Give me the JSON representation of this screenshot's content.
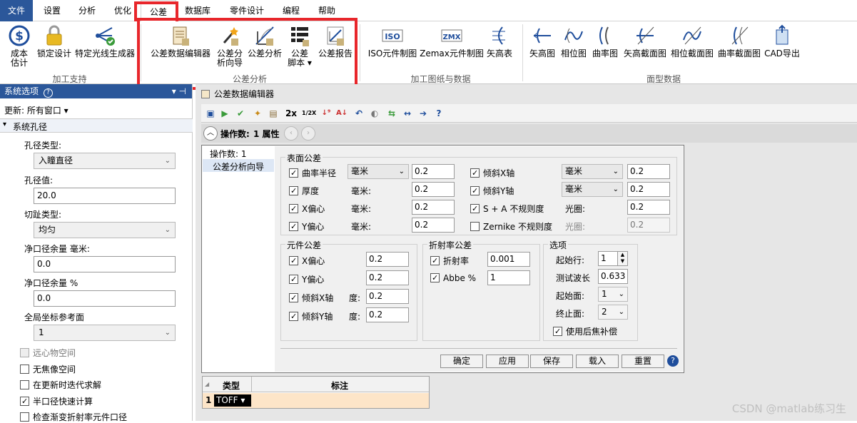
{
  "menu": {
    "file": "文件",
    "items": [
      "设置",
      "分析",
      "优化",
      "公差",
      "数据库",
      "零件设计",
      "编程",
      "帮助"
    ]
  },
  "ribbon": {
    "machining": {
      "cost": "成本\n估计",
      "lock": "锁定设计",
      "ray": "特定光线生成器",
      "label": "加工支持"
    },
    "tolerance": {
      "editor": "公差数据编辑器",
      "wizard1": "公差分",
      "wizard2": "析向导",
      "analysis": "公差分析",
      "script1": "公差",
      "script2": "脚本 ▾",
      "report": "公差报告",
      "label": "公差分析"
    },
    "drawing": {
      "iso": "ISO元件制图",
      "zemax": "Zemax元件制图",
      "sag": "矢高表",
      "label": "加工图纸与数据"
    },
    "surface": {
      "sagmap": "矢高图",
      "phasemap": "相位图",
      "curvmap": "曲率图",
      "sagcross": "矢高截面图",
      "phasecross": "相位截面图",
      "curvcross": "曲率截面图",
      "cad": "CAD导出",
      "label": "面型数据"
    }
  },
  "left": {
    "title": "系统选项",
    "update": "更新: 所有窗口 ▾",
    "section": "系统孔径",
    "aperture_type_label": "孔径类型:",
    "aperture_type": "入瞳直径",
    "aperture_value_label": "孔径值:",
    "aperture_value": "20.0",
    "apodization_label": "切趾类型:",
    "apodization": "均匀",
    "clear_mm_label": "净口径余量 毫米:",
    "clear_mm": "0.0",
    "clear_pct_label": "净口径余量 %",
    "clear_pct": "0.0",
    "global_ref_label": "全局坐标参考面",
    "global_ref": "1",
    "checks": [
      {
        "label": "远心物空间",
        "checked": false,
        "disabled": true
      },
      {
        "label": "无焦像空间",
        "checked": false,
        "disabled": false
      },
      {
        "label": "在更新时迭代求解",
        "checked": false,
        "disabled": false
      },
      {
        "label": "半口径快速计算",
        "checked": true,
        "disabled": false
      },
      {
        "label": "检查渐变折射率元件口径",
        "checked": false,
        "disabled": false
      }
    ]
  },
  "editor": {
    "window_title": "公差数据编辑器",
    "ops_label": "操作数:",
    "ops_value": "1 属性",
    "tree": [
      "操作数: 1",
      "公差分析向导"
    ],
    "surface_tol": {
      "title": "表面公差",
      "rows": [
        {
          "label": "曲率半径",
          "unit": "毫米",
          "unit_select": true,
          "value": "0.2",
          "checked": true
        },
        {
          "label": "厚度",
          "unit": "毫米:",
          "unit_select": false,
          "value": "0.2",
          "checked": true
        },
        {
          "label": "X偏心",
          "unit": "毫米:",
          "unit_select": false,
          "value": "0.2",
          "checked": true
        },
        {
          "label": "Y偏心",
          "unit": "毫米:",
          "unit_select": false,
          "value": "0.2",
          "checked": true
        }
      ],
      "rows_right": [
        {
          "label": "倾斜X轴",
          "unit": "毫米",
          "unit_select": true,
          "value": "0.2",
          "checked": true,
          "disabled": false
        },
        {
          "label": "倾斜Y轴",
          "unit": "毫米",
          "unit_select": true,
          "value": "0.2",
          "checked": true,
          "disabled": false
        },
        {
          "label": "S + A 不规则度",
          "unit": "光圈:",
          "unit_select": false,
          "value": "0.2",
          "checked": true,
          "disabled": false
        },
        {
          "label": "Zernike 不规则度",
          "unit": "光圈:",
          "unit_select": false,
          "value": "0.2",
          "checked": false,
          "disabled": true
        }
      ]
    },
    "element_tol": {
      "title": "元件公差",
      "rows": [
        {
          "label": "X偏心",
          "unit": "",
          "value": "0.2"
        },
        {
          "label": "Y偏心",
          "unit": "",
          "value": "0.2"
        },
        {
          "label": "倾斜X轴",
          "unit": "度:",
          "value": "0.2"
        },
        {
          "label": "倾斜Y轴",
          "unit": "度:",
          "value": "0.2"
        }
      ]
    },
    "index_tol": {
      "title": "折射率公差",
      "index_label": "折射率",
      "index_value": "0.001",
      "abbe_label": "Abbe %",
      "abbe_value": "1"
    },
    "options": {
      "title": "选项",
      "start_row_label": "起始行:",
      "start_row": "1",
      "wavelength_label": "测试波长",
      "wavelength": "0.633",
      "start_surf_label": "起始面:",
      "start_surf": "1",
      "end_surf_label": "终止面:",
      "end_surf": "2",
      "backfocus_label": "使用后焦补偿"
    },
    "buttons": {
      "ok": "确定",
      "apply": "应用",
      "save": "保存",
      "load": "载入",
      "reset": "重置"
    }
  },
  "table": {
    "col_type": "类型",
    "col_note": "标注",
    "row_num": "1",
    "row_type": "TOFF ▾"
  },
  "watermark": "CSDN @matlab练习生",
  "colors": {
    "accent": "#2b579a",
    "highlight": "#e8262b",
    "row_bg": "#fde5c8"
  }
}
